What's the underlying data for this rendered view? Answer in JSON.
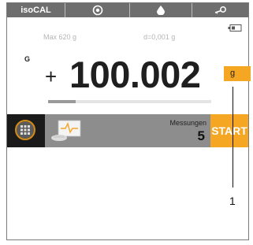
{
  "statusbar": {
    "app_label": "isoCAL",
    "icons": [
      "level-target-icon",
      "drop-icon",
      "key-icon"
    ]
  },
  "weighing": {
    "max_info": "Max 620 g",
    "d_info": "d=0,001 g",
    "mode_label": "G",
    "sign": "+",
    "value": "100.002",
    "unit": "g",
    "capacity_fill_fraction": 0.17
  },
  "bottom": {
    "measurements_label": "Messungen",
    "measurements_count": "5",
    "start_label": "START"
  },
  "callout": {
    "number": "1"
  },
  "colors": {
    "accent": "#f5a623",
    "topbar": "#6e6e6e",
    "bottombar": "#8d8d8d"
  }
}
